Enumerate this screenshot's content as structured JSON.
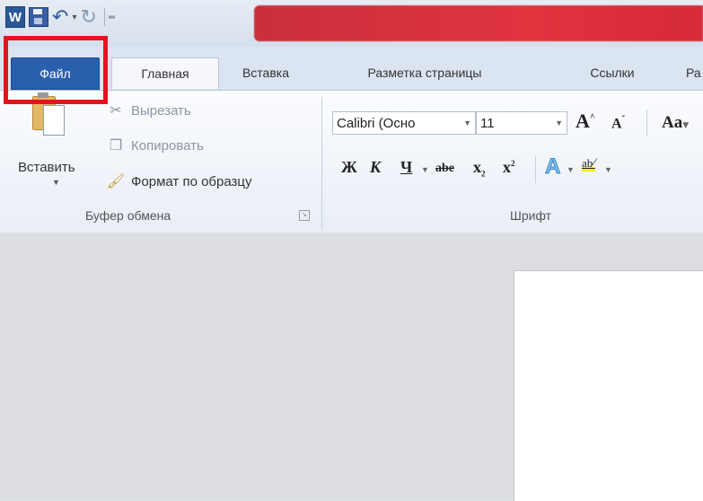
{
  "quick_access": {
    "logo_letter": "W"
  },
  "tabs": {
    "file": "Файл",
    "home": "Главная",
    "insert": "Вставка",
    "page_layout": "Разметка страницы",
    "references": "Ссылки",
    "next_partial": "Ра"
  },
  "clipboard": {
    "paste": "Вставить",
    "cut": "Вырезать",
    "copy": "Копировать",
    "format_painter": "Формат по образцу",
    "group_label": "Буфер обмена"
  },
  "font": {
    "font_name": "Calibri (Осно",
    "font_size": "11",
    "grow": "A",
    "shrink": "A",
    "change_case": "Aa",
    "bold": "Ж",
    "italic": "К",
    "underline": "Ч",
    "strike": "abe",
    "subscript": "x",
    "superscript": "x",
    "text_effects": "A",
    "highlight": "ab",
    "group_label": "Шрифт"
  },
  "colors": {
    "file_tab": "#2a5fae",
    "highlight_box": "#e3141f",
    "title_red": "#e0343f"
  }
}
